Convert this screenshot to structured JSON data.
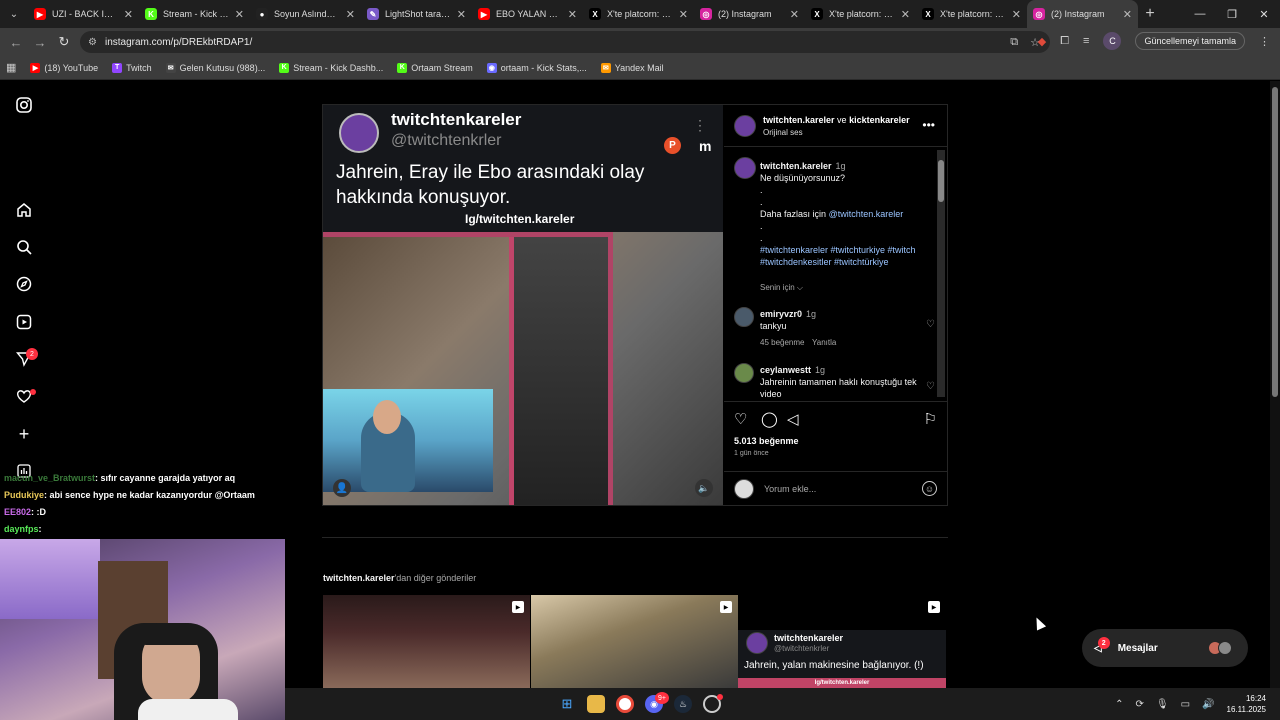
{
  "browser": {
    "tabs": [
      {
        "label": "UZI - BACK IN BU",
        "color": "#ff0000",
        "glyph": "▶"
      },
      {
        "label": "Stream - Kick Das",
        "color": "#53fc18",
        "glyph": "K"
      },
      {
        "label": "Soyun Aslında Ha",
        "color": "#222222",
        "glyph": "●"
      },
      {
        "label": "LightShot tarafın",
        "color": "#7a5ac8",
        "glyph": "✎"
      },
      {
        "label": "EBO YALAN MAKİ",
        "color": "#ff0000",
        "glyph": "▶"
      },
      {
        "label": "X'te platcorn: \"Kic",
        "color": "#000000",
        "glyph": "X"
      },
      {
        "label": "(2) Instagram",
        "color": "#d6249f",
        "glyph": "◎"
      },
      {
        "label": "X'te platcorn: \"Kic",
        "color": "#000000",
        "glyph": "X"
      },
      {
        "label": "X'te platcorn: \"As",
        "color": "#000000",
        "glyph": "X"
      },
      {
        "label": "(2) Instagram",
        "color": "#d6249f",
        "glyph": "◎"
      }
    ],
    "url": "instagram.com/p/DREkbtRDAP1/",
    "profile_initial": "C",
    "update_label": "Güncellemeyi tamamla",
    "bookmarks": [
      {
        "label": "(18) YouTube",
        "color": "#ff0000",
        "glyph": "▶"
      },
      {
        "label": "Twitch",
        "color": "#9146ff",
        "glyph": "T"
      },
      {
        "label": "Gelen Kutusu (988)...",
        "color": "#444444",
        "glyph": "✉"
      },
      {
        "label": "Stream - Kick Dashb...",
        "color": "#53fc18",
        "glyph": "K"
      },
      {
        "label": "Ortaam Stream",
        "color": "#53fc18",
        "glyph": "K"
      },
      {
        "label": "ortaam - Kick Stats,...",
        "color": "#6a6aff",
        "glyph": "◉"
      },
      {
        "label": "Yandex Mail",
        "color": "#ff9900",
        "glyph": "✉"
      }
    ]
  },
  "sidebar": {
    "notifications_badge": "2"
  },
  "post": {
    "media": {
      "username": "twitchtenkareler",
      "handle": "@twitchtenkrler",
      "caption": "Jahrein, Eray ile Ebo arasındaki olay hakkında konuşuyor.",
      "watermark": "Ig/twitchten.kareler",
      "m_label": "m",
      "p_label": "P"
    },
    "header": {
      "author": "twitchten.kareler",
      "joiner": "ve",
      "coauthor": "kicktenkareler",
      "audio": "Orijinal ses"
    },
    "caption_comment": {
      "user": "twitchten.kareler",
      "time": "1g",
      "line1": "Ne düşünüyorsunuz?",
      "dot1": ".",
      "dot2": ".",
      "more_prefix": "Daha fazlası için",
      "more_link": "@twitchten.kareler",
      "dot3": ".",
      "dot4": ".",
      "tags1": "#twitchtenkareler #twitchturkiye #twitch",
      "tags2": "#twitchdenkesitler #twitchtürkiye"
    },
    "for_you": "Senin için",
    "comments": [
      {
        "user": "emiryvzr0",
        "time": "1g",
        "text": "tankyu",
        "likes": "45 beğenme",
        "reply": "Yanıtla"
      },
      {
        "user": "ceylanwestt",
        "time": "1g",
        "text": "Jahreinin tamamen haklı konuştuğu tek video"
      }
    ],
    "likes": "5.013 beğenme",
    "ago": "1 gün önce",
    "add_comment_placeholder": "Yorum ekle..."
  },
  "more_from": {
    "user": "twitchten.kareler",
    "suffix": "'dan diğer gönderiler",
    "card": {
      "name": "twitchtenkareler",
      "handle": "@twitchtenkrler",
      "caption": "Jahrein, yalan makinesine bağlanıyor. (!)",
      "bar": "Ig/twitchten.kareler"
    }
  },
  "messages": {
    "label": "Mesajlar",
    "badge": "2"
  },
  "stream_chat": [
    {
      "user": "macun_ve_Bratwurst",
      "text": ": sıfır cayanne garajda yatıyor aq",
      "color": "#3a7a3a"
    },
    {
      "user": "Pudukiye",
      "text": ": abi sence hype ne kadar kazanıyordur @Ortaam",
      "color": "#e8c858"
    },
    {
      "user": "EE802",
      "text": ": :D",
      "color": "#c86ae8"
    },
    {
      "user": "daynfps",
      "text": ":",
      "color": "#58e858"
    }
  ],
  "clock": {
    "time": "16:24",
    "date": "16.11.2025"
  },
  "taskbar_badge": "9+"
}
